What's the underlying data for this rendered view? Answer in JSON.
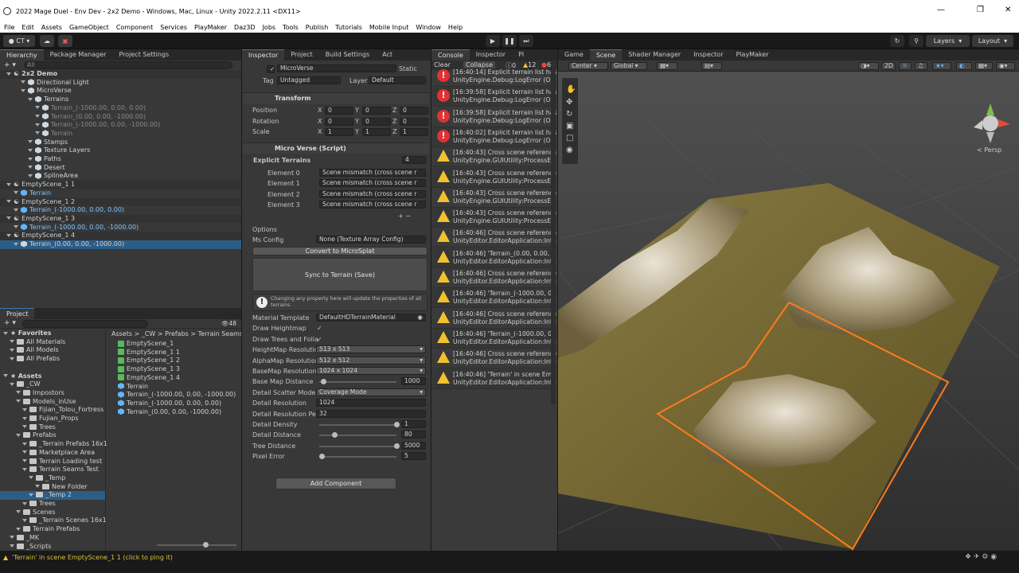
{
  "window": {
    "title": "2022 Mage Duel - Env Dev - 2x2 Demo - Windows, Mac, Linux - Unity 2022.2.11 <DX11>"
  },
  "menu": [
    "File",
    "Edit",
    "Assets",
    "GameObject",
    "Component",
    "Services",
    "PlayMaker",
    "Daz3D",
    "Jobs",
    "Tools",
    "Publish",
    "Tutorials",
    "Mobile Input",
    "Window",
    "Help"
  ],
  "toolbar": {
    "account": "CT",
    "layers": "Layers",
    "layout": "Layout"
  },
  "hierarchy": {
    "tabs": [
      "Hierarchy",
      "Package Manager",
      "Project Settings"
    ],
    "search_placeholder": "All",
    "rows": [
      {
        "text": "2x2 Demo",
        "indent": 0,
        "kind": "scene",
        "bold": true,
        "dim": false,
        "sel": false
      },
      {
        "text": "Directional Light",
        "indent": 2,
        "kind": "cube",
        "dim": false,
        "sel": false
      },
      {
        "text": "MicroVerse",
        "indent": 2,
        "kind": "cube",
        "dim": false,
        "sel": false
      },
      {
        "text": "Terrains",
        "indent": 3,
        "kind": "cube",
        "dim": false,
        "sel": false
      },
      {
        "text": "Terrain_(-1000.00, 0.00, 0.00)",
        "indent": 4,
        "kind": "cube",
        "dim": true,
        "sel": false
      },
      {
        "text": "Terrain_(0.00, 0.00, -1000.00)",
        "indent": 4,
        "kind": "cube",
        "dim": true,
        "sel": false
      },
      {
        "text": "Terrain_(-1000.00, 0.00, -1000.00)",
        "indent": 4,
        "kind": "cube",
        "dim": true,
        "sel": false
      },
      {
        "text": "Terrain",
        "indent": 4,
        "kind": "cube",
        "dim": true,
        "sel": false
      },
      {
        "text": "Stamps",
        "indent": 3,
        "kind": "cube",
        "dim": false,
        "sel": false
      },
      {
        "text": "Texture Layers",
        "indent": 3,
        "kind": "cube",
        "dim": false,
        "sel": false
      },
      {
        "text": "Paths",
        "indent": 3,
        "kind": "cube",
        "dim": false,
        "sel": false
      },
      {
        "text": "Desert",
        "indent": 3,
        "kind": "cube",
        "dim": false,
        "sel": false
      },
      {
        "text": "SplineArea",
        "indent": 3,
        "kind": "cube",
        "dim": false,
        "sel": false
      },
      {
        "text": "EmptyScene_1 1",
        "indent": 0,
        "kind": "scene",
        "dim": false,
        "sel": false
      },
      {
        "text": "Terrain",
        "indent": 1,
        "kind": "cube",
        "dim": false,
        "sel": false,
        "blue": true
      },
      {
        "text": "EmptyScene_1 2",
        "indent": 0,
        "kind": "scene",
        "dim": false,
        "sel": false
      },
      {
        "text": "Terrain_(-1000.00, 0.00, 0.00)",
        "indent": 1,
        "kind": "cube",
        "dim": false,
        "sel": false,
        "blue": true
      },
      {
        "text": "EmptyScene_1 3",
        "indent": 0,
        "kind": "scene",
        "dim": false,
        "sel": false
      },
      {
        "text": "Terrain_(-1000.00, 0.00, -1000.00)",
        "indent": 1,
        "kind": "cube",
        "dim": false,
        "sel": false,
        "blue": true
      },
      {
        "text": "EmptyScene_1 4",
        "indent": 0,
        "kind": "scene",
        "dim": false,
        "sel": false
      },
      {
        "text": "Terrain_(0.00, 0.00, -1000.00)",
        "indent": 1,
        "kind": "cube",
        "dim": false,
        "sel": true
      }
    ]
  },
  "project": {
    "tab": "Project",
    "count": "48",
    "breadcrumb": [
      "Assets",
      "_CW",
      "Prefabs",
      "Terrain Seams"
    ],
    "tree": [
      {
        "text": "Favorites",
        "indent": 0,
        "bold": true
      },
      {
        "text": "All Materials",
        "indent": 1
      },
      {
        "text": "All Models",
        "indent": 1
      },
      {
        "text": "All Prefabs",
        "indent": 1
      },
      {
        "text": "",
        "indent": 0
      },
      {
        "text": "Assets",
        "indent": 0,
        "bold": true
      },
      {
        "text": "_CW",
        "indent": 1
      },
      {
        "text": "Impostors",
        "indent": 2
      },
      {
        "text": "Models_inUse",
        "indent": 2
      },
      {
        "text": "Fijian_Tolou_Fortress",
        "indent": 3
      },
      {
        "text": "Fujian_Props",
        "indent": 3
      },
      {
        "text": "Trees",
        "indent": 3
      },
      {
        "text": "Prefabs",
        "indent": 2
      },
      {
        "text": "_Terrain Prefabs 16x1",
        "indent": 3
      },
      {
        "text": "Marketplace Area",
        "indent": 3
      },
      {
        "text": "Terrain Loading test",
        "indent": 3
      },
      {
        "text": "Terrain Seams Test",
        "indent": 3
      },
      {
        "text": "_Temp",
        "indent": 4
      },
      {
        "text": "New Folder",
        "indent": 5
      },
      {
        "text": "_Temp 2",
        "indent": 4,
        "sel": true
      },
      {
        "text": "Trees",
        "indent": 3
      },
      {
        "text": "Scenes",
        "indent": 2
      },
      {
        "text": "_Terrain Scenes 16x1",
        "indent": 3
      },
      {
        "text": "Terrain Prefabs",
        "indent": 2
      },
      {
        "text": "_MK",
        "indent": 1
      },
      {
        "text": "_Scripts",
        "indent": 1
      }
    ],
    "files": [
      "EmptyScene_1",
      "EmptyScene_1 1",
      "EmptyScene_1 2",
      "EmptyScene_1 3",
      "EmptyScene_1 4",
      "Terrain",
      "Terrain_(-1000.00, 0.00, -1000.00)",
      "Terrain_(-1000.00, 0.00, 0.00)",
      "Terrain_(0.00, 0.00, -1000.00)"
    ]
  },
  "inspector": {
    "tabs": [
      "Inspector",
      "Project",
      "Build Settings",
      "Act"
    ],
    "name": "MicroVerse",
    "static": "Static",
    "tag_label": "Tag",
    "tag": "Untagged",
    "layer_label": "Layer",
    "layer": "Default",
    "transform": {
      "title": "Transform",
      "rows": [
        {
          "label": "Position",
          "x": "0",
          "y": "0",
          "z": "0"
        },
        {
          "label": "Rotation",
          "x": "0",
          "y": "0",
          "z": "0"
        },
        {
          "label": "Scale",
          "x": "1",
          "y": "1",
          "z": "1"
        }
      ]
    },
    "script": {
      "title": "Micro Verse (Script)",
      "explicit": "Explicit Terrains",
      "count": "4",
      "elements": [
        {
          "label": "Element 0",
          "value": "Scene mismatch (cross scene r"
        },
        {
          "label": "Element 1",
          "value": "Scene mismatch (cross scene r"
        },
        {
          "label": "Element 2",
          "value": "Scene mismatch (cross scene r"
        },
        {
          "label": "Element 3",
          "value": "Scene mismatch (cross scene r"
        }
      ],
      "options": "Options",
      "ms_config_label": "Ms Config",
      "ms_config": "None (Texture Array Config)",
      "convert": "Convert to MicroSplat",
      "sync": "Sync to Terrain (Save)",
      "note": "Changing any property here will update the properties of all terrains",
      "props": [
        {
          "label": "Material Template",
          "value": "DefaultHDTerrainMaterial",
          "type": "obj"
        },
        {
          "label": "Draw Heightmap",
          "value": "✓",
          "type": "check"
        },
        {
          "label": "Draw Trees and Folia",
          "value": "✓",
          "type": "check"
        },
        {
          "label": "HeightMap Resolution",
          "value": "513 x 513",
          "type": "drop"
        },
        {
          "label": "AlphaMap Resolution",
          "value": "512 x 512",
          "type": "drop"
        },
        {
          "label": "BaseMap Resolution",
          "value": "1024 x 1024",
          "type": "drop"
        },
        {
          "label": "Base Map Distance",
          "value": "1000",
          "type": "slider",
          "frac": 0.05
        },
        {
          "label": "Detail Scatter Mode",
          "value": "Coverage Mode",
          "type": "drop"
        },
        {
          "label": "Detail Resolution",
          "value": "1024",
          "type": "text"
        },
        {
          "label": "Detail Resolution Per",
          "value": "32",
          "type": "text"
        },
        {
          "label": "Detail Density",
          "value": "1",
          "type": "slider",
          "frac": 1.0
        },
        {
          "label": "Detail Distance",
          "value": "80",
          "type": "slider",
          "frac": 0.2
        },
        {
          "label": "Tree Distance",
          "value": "5000",
          "type": "slider",
          "frac": 1.0
        },
        {
          "label": "Pixel Error",
          "value": "5",
          "type": "slider",
          "frac": 0.03
        }
      ],
      "add_component": "Add Component"
    }
  },
  "console": {
    "tabs": [
      "Console",
      "Inspector",
      "Pl"
    ],
    "clear": "Clear",
    "collapse": "Collapse",
    "counts": {
      "info": "0",
      "warn": "12",
      "err": "6"
    },
    "logs": [
      {
        "type": "err",
        "l1": "[16:40:14] Explicit terrain list has",
        "l2": "UnityEngine.Debug:LogError (Obje"
      },
      {
        "type": "err",
        "l1": "[16:39:58] Explicit terrain list has",
        "l2": "UnityEngine.Debug:LogError (Obje"
      },
      {
        "type": "err",
        "l1": "[16:39:58] Explicit terrain list has",
        "l2": "UnityEngine.Debug:LogError (Obje"
      },
      {
        "type": "err",
        "l1": "[16:40:02] Explicit terrain list has",
        "l2": "UnityEngine.Debug:LogError (Obje"
      },
      {
        "type": "warn",
        "l1": "[16:40:43] Cross scene reference",
        "l2": "UnityEngine.GUIUtility:ProcessEv"
      },
      {
        "type": "warn",
        "l1": "[16:40:43] Cross scene reference",
        "l2": "UnityEngine.GUIUtility:ProcessEv"
      },
      {
        "type": "warn",
        "l1": "[16:40:43] Cross scene reference",
        "l2": "UnityEngine.GUIUtility:ProcessEv"
      },
      {
        "type": "warn",
        "l1": "[16:40:43] Cross scene reference",
        "l2": "UnityEngine.GUIUtility:ProcessEv"
      },
      {
        "type": "warn",
        "l1": "[16:40:46] Cross scene reference",
        "l2": "UnityEditor.EditorApplication:Inter"
      },
      {
        "type": "warn",
        "l1": "[16:40:46] 'Terrain_(0.00, 0.00,",
        "l2": "UnityEditor.EditorApplication:Inter"
      },
      {
        "type": "warn",
        "l1": "[16:40:46] Cross scene reference",
        "l2": "UnityEditor.EditorApplication:Inter"
      },
      {
        "type": "warn",
        "l1": "[16:40:46] 'Terrain_(-1000.00, 0.",
        "l2": "UnityEditor.EditorApplication:Inter"
      },
      {
        "type": "warn",
        "l1": "[16:40:46] Cross scene reference",
        "l2": "UnityEditor.EditorApplication:Inter"
      },
      {
        "type": "warn",
        "l1": "[16:40:46] 'Terrain_(-1000.00, 0.",
        "l2": "UnityEditor.EditorApplication:Inter"
      },
      {
        "type": "warn",
        "l1": "[16:40:46] Cross scene reference",
        "l2": "UnityEditor.EditorApplication:Inter"
      },
      {
        "type": "warn",
        "l1": "[16:40:46] 'Terrain' in scene Emp",
        "l2": "UnityEditor.EditorApplication:Inter"
      }
    ]
  },
  "scene": {
    "tabs": [
      "Game",
      "Scene",
      "Shader Manager",
      "Inspector",
      "PlayMaker"
    ],
    "pivot": "Center",
    "space": "Global",
    "mode": "2D",
    "persp": "< Persp"
  },
  "status": {
    "message": "'Terrain' in scene EmptyScene_1 1 (click to ping it)"
  },
  "colors": {
    "accent": "#2c5d87",
    "selection_outline": "#ff7b1c",
    "warn": "#f2c12e",
    "error": "#dd3333"
  }
}
